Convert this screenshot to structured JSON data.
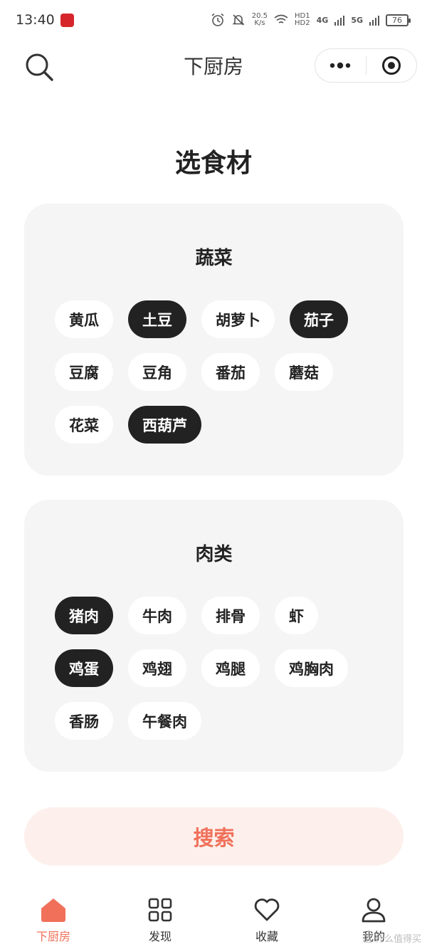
{
  "status_bar": {
    "time": "13:40",
    "net_speed_value": "20.5",
    "net_speed_unit": "K/s",
    "hd_1": "HD1",
    "hd_2": "HD2",
    "net_4g": "4G",
    "net_5g": "5G",
    "battery": "76"
  },
  "nav": {
    "title": "下厨房"
  },
  "page": {
    "heading": "选食材"
  },
  "categories": [
    {
      "title": "蔬菜",
      "items": [
        {
          "label": "黄瓜",
          "selected": false
        },
        {
          "label": "土豆",
          "selected": true
        },
        {
          "label": "胡萝卜",
          "selected": false
        },
        {
          "label": "茄子",
          "selected": true
        },
        {
          "label": "豆腐",
          "selected": false
        },
        {
          "label": "豆角",
          "selected": false
        },
        {
          "label": "番茄",
          "selected": false
        },
        {
          "label": "蘑菇",
          "selected": false
        },
        {
          "label": "花菜",
          "selected": false
        },
        {
          "label": "西葫芦",
          "selected": true
        }
      ]
    },
    {
      "title": "肉类",
      "items": [
        {
          "label": "猪肉",
          "selected": true
        },
        {
          "label": "牛肉",
          "selected": false
        },
        {
          "label": "排骨",
          "selected": false
        },
        {
          "label": "虾",
          "selected": false
        },
        {
          "label": "鸡蛋",
          "selected": true
        },
        {
          "label": "鸡翅",
          "selected": false
        },
        {
          "label": "鸡腿",
          "selected": false
        },
        {
          "label": "鸡胸肉",
          "selected": false
        },
        {
          "label": "香肠",
          "selected": false
        },
        {
          "label": "午餐肉",
          "selected": false
        }
      ]
    }
  ],
  "search_button": {
    "label": "搜索"
  },
  "tabs": [
    {
      "label": "下厨房",
      "icon": "home-icon",
      "active": true
    },
    {
      "label": "发现",
      "icon": "grid-icon",
      "active": false
    },
    {
      "label": "收藏",
      "icon": "heart-icon",
      "active": false
    },
    {
      "label": "我的",
      "icon": "user-icon",
      "active": false
    }
  ],
  "watermark": "值 什么值得买",
  "colors": {
    "accent": "#f0705a",
    "accent_bg": "#fdf0ec",
    "chip_selected": "#222222",
    "chip_default": "#ffffff",
    "card_bg": "#f5f5f5"
  }
}
